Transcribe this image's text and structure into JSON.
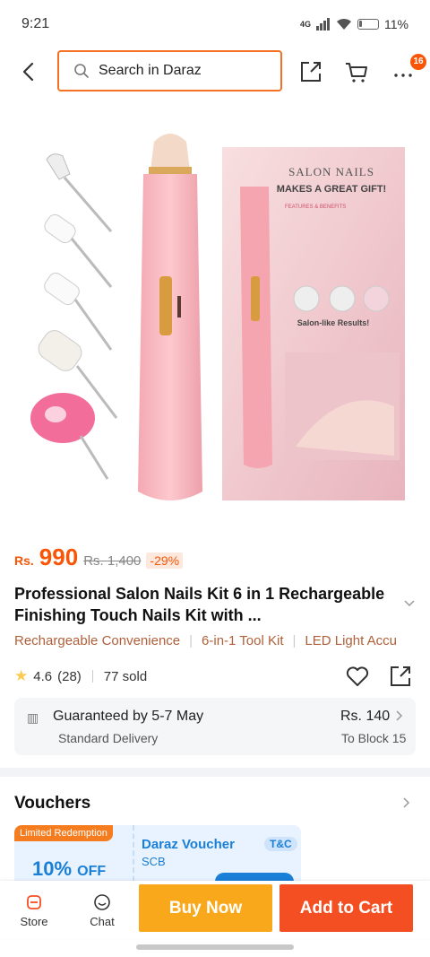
{
  "status": {
    "time": "9:21",
    "network": "4G",
    "battery": "11%"
  },
  "search": {
    "placeholder": "Search in Daraz"
  },
  "nav": {
    "more_badge": "16"
  },
  "product_image": {
    "box_heading": "SALON NAILS",
    "box_tagline": "MAKES A GREAT GIFT!",
    "box_features_title": "FEATURES & BENEFITS",
    "box_footer": "Salon-like Results!"
  },
  "price": {
    "currency": "Rs.",
    "current": "990",
    "original": "Rs. 1,400",
    "discount": "-29%"
  },
  "product": {
    "title": "Professional Salon Nails Kit 6 in 1 Rechargeable Finishing Touch Nails Kit with ..."
  },
  "highlights": [
    "Rechargeable Convenience",
    "6-in-1 Tool Kit",
    "LED Light Accu"
  ],
  "rating": {
    "score": "4.6",
    "count": "(28)",
    "sold": "77 sold"
  },
  "delivery": {
    "title": "Guaranteed by 5-7 May",
    "subtitle": "Standard Delivery",
    "price": "Rs. 140",
    "to": "To Block 15"
  },
  "vouchers": {
    "title": "Vouchers",
    "tag": "Limited Redemption",
    "off_value": "10%",
    "off_label": "OFF",
    "name": "Daraz Voucher",
    "bank": "SCB",
    "tc": "T&C"
  },
  "bottom_bar": {
    "store_label": "Store",
    "chat_label": "Chat",
    "buy_now_label": "Buy Now",
    "add_to_cart_label": "Add to Cart"
  },
  "colors": {
    "accent": "#f85606",
    "buy_now": "#f9a81b",
    "add_to_cart": "#f44f22",
    "voucher": "#1a7fd6"
  }
}
